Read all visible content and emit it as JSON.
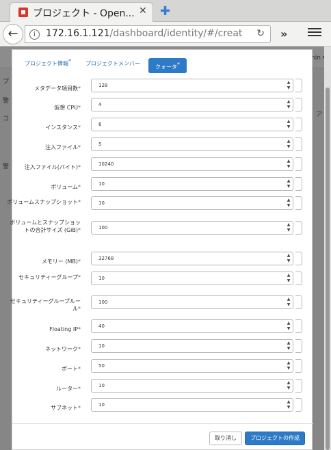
{
  "browser": {
    "tab_title": "プロジェクト - Open...",
    "tab_close": "✕",
    "new_tab": "✚",
    "url_host": "172.16.1.121",
    "url_path": "/dashboard/identity/#/creat",
    "back": "←",
    "reload": "↻",
    "overflow": "»"
  },
  "modal": {
    "tabs": [
      {
        "label": "プロジェクト情報",
        "required": "*"
      },
      {
        "label": "プロジェクトメンバー",
        "required": ""
      },
      {
        "label": "クォータ",
        "required": "*"
      }
    ],
    "fields": [
      {
        "label": "メタデータ項目数",
        "required": "*",
        "value": "128"
      },
      {
        "label": "仮想 CPU",
        "required": "*",
        "value": "4"
      },
      {
        "label": "インスタンス",
        "required": "*",
        "value": "6"
      },
      {
        "label": "注入ファイル",
        "required": "*",
        "value": "5"
      },
      {
        "label": "注入ファイル(バイト)",
        "required": "*",
        "value": "10240"
      },
      {
        "label": "ボリューム",
        "required": "*",
        "value": "10"
      },
      {
        "label": "ボリュームスナップショット",
        "required": "*",
        "value": "10"
      },
      {
        "label": "ボリュームとスナップショットの合計サイズ (GiB)",
        "required": "*",
        "value": "100"
      },
      {
        "label": "メモリー (MB)",
        "required": "*",
        "value": "32768"
      },
      {
        "label": "セキュリティーグループ",
        "required": "*",
        "value": "10"
      },
      {
        "label": "セキュリティーグループルール",
        "required": "*",
        "value": "100"
      },
      {
        "label": "Floating IP",
        "required": "*",
        "value": "40"
      },
      {
        "label": "ネットワーク",
        "required": "*",
        "value": "10"
      },
      {
        "label": "ポート",
        "required": "*",
        "value": "50"
      },
      {
        "label": "ルーター",
        "required": "*",
        "value": "10"
      },
      {
        "label": "サブネット",
        "required": "*",
        "value": "10"
      }
    ],
    "cancel_label": "取り消し",
    "create_label": "プロジェクトの作成"
  },
  "background": {
    "items": [
      "min ▾",
      "プ",
      "警",
      "コ",
      "警",
      "ア"
    ]
  }
}
